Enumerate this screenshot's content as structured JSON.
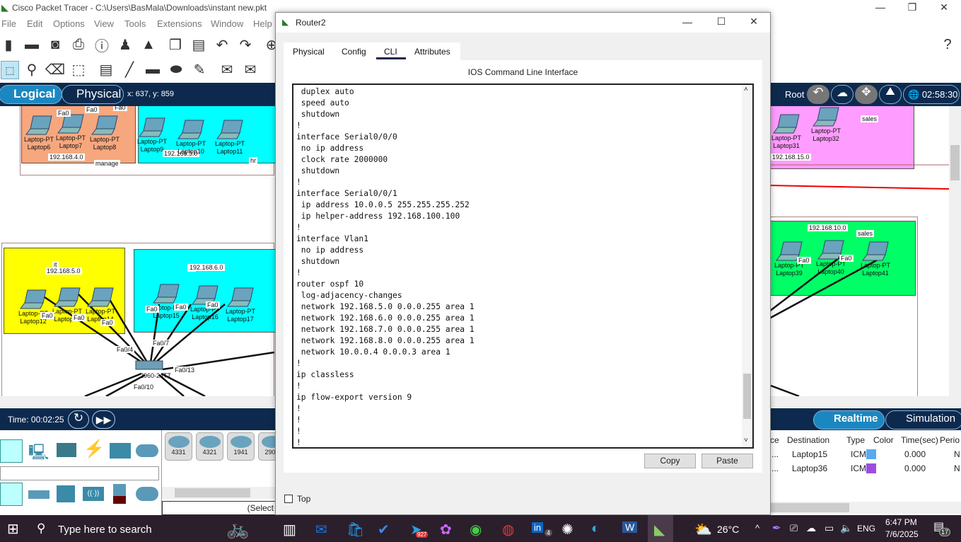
{
  "app": {
    "title": "Cisco Packet Tracer - C:\\Users\\BasMala\\Downloads\\instant new.pkt",
    "menu": [
      "File",
      "Edit",
      "Options",
      "View",
      "Tools",
      "Extensions",
      "Window",
      "Help"
    ],
    "help_icon": "?"
  },
  "navbar": {
    "logical": "Logical",
    "physical": "Physical",
    "coords": "x: 637, y: 859",
    "root": "Root",
    "clock": "02:58:30"
  },
  "canvas": {
    "zones": [
      {
        "label": "manage",
        "network": "192.168.4.0",
        "color": "#f7a77e"
      },
      {
        "label": "hr",
        "network": "192.168.3.0",
        "color": "#00ffff"
      },
      {
        "label": "it",
        "network": "192.168.5.0",
        "color": "#ffff00"
      },
      {
        "label": "hr",
        "network": "192.168.6.0",
        "color": "#00ffff"
      },
      {
        "label": "sales",
        "network": "192.168.15.0",
        "color": "#ff9cff"
      },
      {
        "label": "sales",
        "network": "192.168.10.0",
        "color": "#00ff66"
      }
    ],
    "nodes": [
      {
        "type": "Laptop-PT",
        "name": "Laptop6"
      },
      {
        "type": "Laptop-PT",
        "name": "Laptop7"
      },
      {
        "type": "Laptop-PT",
        "name": "Laptop8"
      },
      {
        "type": "Laptop-PT",
        "name": "Laptop9"
      },
      {
        "type": "Laptop-PT",
        "name": "Laptop10"
      },
      {
        "type": "Laptop-PT",
        "name": "Laptop11"
      },
      {
        "type": "Laptop-PT",
        "name": "Laptop12"
      },
      {
        "type": "Laptop-PT",
        "name": "Laptop13"
      },
      {
        "type": "Laptop-PT",
        "name": "Laptop14"
      },
      {
        "type": "Laptop-PT",
        "name": "Laptop15"
      },
      {
        "type": "Laptop-PT",
        "name": "Laptop16"
      },
      {
        "type": "Laptop-PT",
        "name": "Laptop17"
      },
      {
        "type": "Laptop-PT",
        "name": "Laptop31"
      },
      {
        "type": "Laptop-PT",
        "name": "Laptop32"
      },
      {
        "type": "Laptop-PT",
        "name": "Laptop39"
      },
      {
        "type": "Laptop-PT",
        "name": "Laptop40"
      },
      {
        "type": "Laptop-PT",
        "name": "Laptop41"
      }
    ],
    "port_labels": [
      "Fa0",
      "Fa0",
      "Fa0",
      "Fa0",
      "Fa0",
      "Fa0",
      "Fa0",
      "Fa0",
      "Fa0",
      "Fa0",
      "Fa0/4",
      "Fa0/7",
      "Fa0/13",
      "Fa0/10",
      "Fa0"
    ],
    "switch_label": "2960-24TT"
  },
  "timebar": {
    "time": "Time: 00:02:25",
    "realtime": "Realtime",
    "simulation": "Simulation"
  },
  "devices": {
    "models": [
      "4331",
      "4321",
      "1941",
      "2901"
    ],
    "status": "(Select"
  },
  "pdu_table": {
    "headers": [
      "ce",
      "Destination",
      "Type",
      "Color",
      "Time(sec)",
      "Perio"
    ],
    "rows": [
      {
        "src": "...",
        "dest": "Laptop15",
        "type": "ICMP",
        "color": "#5aaaf0",
        "time": "0.000",
        "period": "N"
      },
      {
        "src": "...",
        "dest": "Laptop36",
        "type": "ICMP",
        "color": "#9b4de0",
        "time": "0.000",
        "period": "N"
      }
    ]
  },
  "router_window": {
    "title": "Router2",
    "tabs": [
      "Physical",
      "Config",
      "CLI",
      "Attributes"
    ],
    "active_tab": "CLI",
    "heading": "IOS Command Line Interface",
    "cli_text": " duplex auto\n speed auto\n shutdown\n!\ninterface Serial0/0/0\n no ip address\n clock rate 2000000\n shutdown\n!\ninterface Serial0/0/1\n ip address 10.0.0.5 255.255.255.252\n ip helper-address 192.168.100.100\n!\ninterface Vlan1\n no ip address\n shutdown\n!\nrouter ospf 10\n log-adjacency-changes\n network 192.168.5.0 0.0.0.255 area 1\n network 192.168.6.0 0.0.0.255 area 1\n network 192.168.7.0 0.0.0.255 area 1\n network 192.168.8.0 0.0.0.255 area 1\n network 10.0.0.4 0.0.0.3 area 1\n!\nip classless\n!\nip flow-export version 9\n!\n!\n!\n!",
    "copy": "Copy",
    "paste": "Paste",
    "top_checkbox": "Top",
    "top_checked": false
  },
  "taskbar": {
    "search_placeholder": "Type here to search",
    "telegram_badge": "927",
    "linkedin_badge": "4",
    "weather": "26°C",
    "lang": "ENG",
    "time": "6:47 PM",
    "date": "7/6/2025",
    "notifications": "17"
  }
}
